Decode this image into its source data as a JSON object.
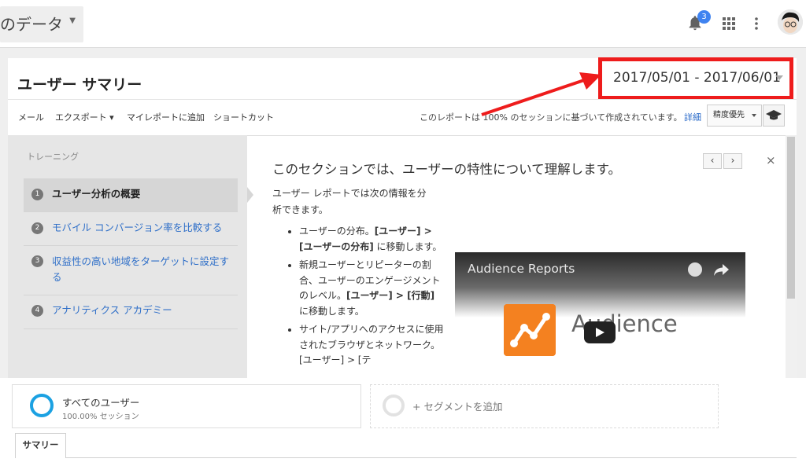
{
  "header": {
    "view_selector": "のデータ",
    "notification_count": "3"
  },
  "report": {
    "title": "ユーザー サマリー",
    "date_range": "2017/05/01 - 2017/06/01"
  },
  "toolbar": {
    "email": "メール",
    "export": "エクスポート ▾",
    "add_to_dashboard": "マイレポートに追加",
    "shortcut": "ショートカット",
    "sampling_note": "このレポートは 100% のセッションに基づいて作成されています。",
    "details": "詳細",
    "precision": "精度優先"
  },
  "training": {
    "heading": "トレーニング",
    "lessons": [
      {
        "num": "1",
        "label": "ユーザー分析の概要"
      },
      {
        "num": "2",
        "label": "モバイル コンバージョン率を比較する"
      },
      {
        "num": "3",
        "label": "収益性の高い地域をターゲットに設定する"
      },
      {
        "num": "4",
        "label": "アナリティクス アカデミー"
      }
    ],
    "content_title": "このセクションでは、ユーザーの特性について理解します。",
    "intro": "ユーザー レポートでは次の情報を分析できます。",
    "bullets": [
      {
        "pre": "ユーザーの分布。",
        "bold": "[ユーザー] > [ユーザーの分布]",
        "post": " に移動します。"
      },
      {
        "pre": "新規ユーザーとリピーターの割合、ユーザーのエンゲージメントのレベル。",
        "bold": "[ユーザー] > [行動]",
        "post": " に移動します。"
      },
      {
        "pre": "サイト/アプリへのアクセスに使用されたブラウザとネットワーク。[ユーザー] > [テ",
        "bold": "",
        "post": ""
      }
    ],
    "nav_prev": "‹",
    "nav_next": "›",
    "close": "×",
    "video": {
      "title": "Audience Reports",
      "brand": "Audience"
    }
  },
  "segments": {
    "all_users": "すべてのユーザー",
    "all_users_sub": "100.00% セッション",
    "add_segment": "+ セグメントを追加"
  },
  "tabs": {
    "summary": "サマリー"
  },
  "colors": {
    "highlight_red": "#ee1c1c",
    "segment_blue": "#1ba1e2",
    "link_blue": "#2f6fc8",
    "analytics_orange": "#f48120"
  }
}
